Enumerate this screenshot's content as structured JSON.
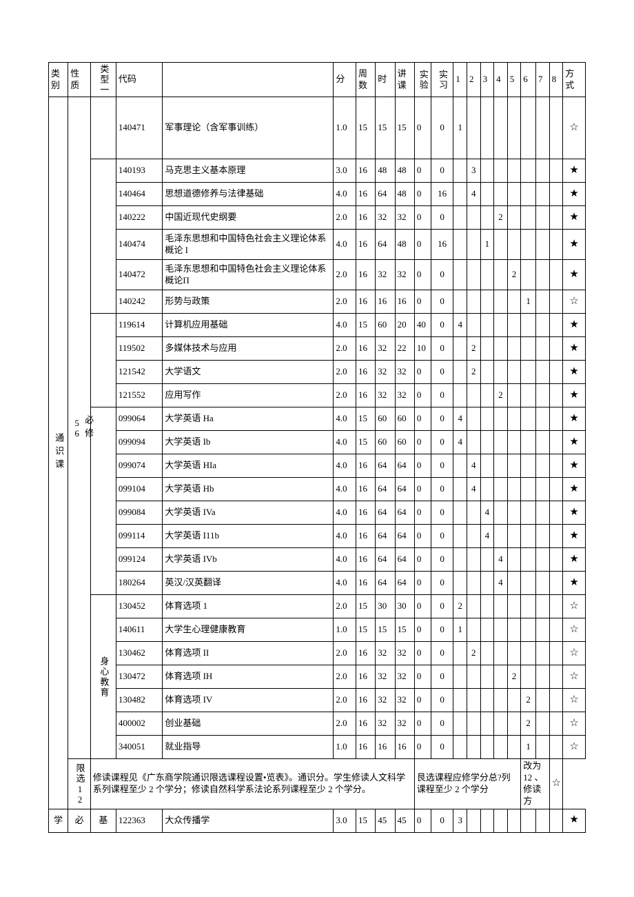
{
  "headers": {
    "cat": "类别",
    "nature": "性质",
    "type": "类型一",
    "code": "代码",
    "name": "",
    "credit": "分",
    "weeks": "周数",
    "hours": "时",
    "lecture": "讲课",
    "exp": "实验",
    "practice": "实习",
    "s1": "1",
    "s2": "2",
    "s3": "3",
    "s4": "4",
    "s5": "5",
    "s6": "6",
    "s7": "7",
    "s8": "8",
    "mode": "方式"
  },
  "left": {
    "tongshike": "通识课",
    "bixiu": "必修",
    "credits56": "56",
    "shenxin": "身心教育",
    "xianxuan": "限选",
    "credits12": "12",
    "xue": "学",
    "bi": "必",
    "ji": "基"
  },
  "rows": [
    {
      "code": "140471",
      "name": "军事理论（含军事训练）",
      "credit": "1.0",
      "weeks": "15",
      "hours": "15",
      "lecture": "15",
      "exp": "0",
      "practice": "0",
      "s1": "1",
      "s2": "",
      "s3": "",
      "s4": "",
      "s5": "",
      "s6": "",
      "s7": "",
      "s8": "",
      "mode": "☆"
    },
    {
      "code": "140193",
      "name": "马克思主义基本原理",
      "credit": "3.0",
      "weeks": "16",
      "hours": "48",
      "lecture": "48",
      "exp": "0",
      "practice": "0",
      "s1": "",
      "s2": "3",
      "s3": "",
      "s4": "",
      "s5": "",
      "s6": "",
      "s7": "",
      "s8": "",
      "mode": "★"
    },
    {
      "code": "140464",
      "name": "思想道德修养与法律基础",
      "credit": "4.0",
      "weeks": "16",
      "hours": "64",
      "lecture": "48",
      "exp": "0",
      "practice": "16",
      "s1": "",
      "s2": "4",
      "s3": "",
      "s4": "",
      "s5": "",
      "s6": "",
      "s7": "",
      "s8": "",
      "mode": "★"
    },
    {
      "code": "140222",
      "name": "中国近现代史纲要",
      "credit": "2.0",
      "weeks": "16",
      "hours": "32",
      "lecture": "32",
      "exp": "0",
      "practice": "0",
      "s1": "",
      "s2": "",
      "s3": "",
      "s4": "2",
      "s5": "",
      "s6": "",
      "s7": "",
      "s8": "",
      "mode": "★"
    },
    {
      "code": "140474",
      "name": "毛泽东思想和中国特色社会主义理论体系概论 I",
      "credit": "4.0",
      "weeks": "16",
      "hours": "64",
      "lecture": "48",
      "exp": "0",
      "practice": "16",
      "s1": "",
      "s2": "",
      "s3": "1",
      "s4": "",
      "s5": "",
      "s6": "",
      "s7": "",
      "s8": "",
      "mode": "★"
    },
    {
      "code": "140472",
      "name": "毛泽东思想和中国特色社会主义理论体系概论Π",
      "credit": "2.0",
      "weeks": "16",
      "hours": "32",
      "lecture": "32",
      "exp": "0",
      "practice": "0",
      "s1": "",
      "s2": "",
      "s3": "",
      "s4": "",
      "s5": "2",
      "s6": "",
      "s7": "",
      "s8": "",
      "mode": "★"
    },
    {
      "code": "140242",
      "name": "形势与政策",
      "credit": "2.0",
      "weeks": "16",
      "hours": "16",
      "lecture": "16",
      "exp": "0",
      "practice": "0",
      "s1": "",
      "s2": "",
      "s3": "",
      "s4": "",
      "s5": "",
      "s6": "1",
      "s7": "",
      "s8": "",
      "mode": "☆"
    },
    {
      "code": "119614",
      "name": "计算机应用基础",
      "credit": "4.0",
      "weeks": "15",
      "hours": "60",
      "lecture": "20",
      "exp": "40",
      "practice": "0",
      "s1": "4",
      "s2": "",
      "s3": "",
      "s4": "",
      "s5": "",
      "s6": "",
      "s7": "",
      "s8": "",
      "mode": "★"
    },
    {
      "code": "119502",
      "name": "多媒体技术与应用",
      "credit": "2.0",
      "weeks": "16",
      "hours": "32",
      "lecture": "22",
      "exp": "10",
      "practice": "0",
      "s1": "",
      "s2": "2",
      "s3": "",
      "s4": "",
      "s5": "",
      "s6": "",
      "s7": "",
      "s8": "",
      "mode": "★"
    },
    {
      "code": "121542",
      "name": "大学语文",
      "credit": "2.0",
      "weeks": "16",
      "hours": "32",
      "lecture": "32",
      "exp": "0",
      "practice": "0",
      "s1": "",
      "s2": "2",
      "s3": "",
      "s4": "",
      "s5": "",
      "s6": "",
      "s7": "",
      "s8": "",
      "mode": "★"
    },
    {
      "code": "121552",
      "name": "应用写作",
      "credit": "2.0",
      "weeks": "16",
      "hours": "32",
      "lecture": "32",
      "exp": "0",
      "practice": "0",
      "s1": "",
      "s2": "",
      "s3": "",
      "s4": "2",
      "s5": "",
      "s6": "",
      "s7": "",
      "s8": "",
      "mode": "★"
    },
    {
      "code": "099064",
      "name": "大学英语 Ha",
      "credit": "4.0",
      "weeks": "15",
      "hours": "60",
      "lecture": "60",
      "exp": "0",
      "practice": "0",
      "s1": "4",
      "s2": "",
      "s3": "",
      "s4": "",
      "s5": "",
      "s6": "",
      "s7": "",
      "s8": "",
      "mode": "★"
    },
    {
      "code": "099094",
      "name": "大学英语 Ib",
      "credit": "4.0",
      "weeks": "15",
      "hours": "60",
      "lecture": "60",
      "exp": "0",
      "practice": "0",
      "s1": "4",
      "s2": "",
      "s3": "",
      "s4": "",
      "s5": "",
      "s6": "",
      "s7": "",
      "s8": "",
      "mode": "★"
    },
    {
      "code": "099074",
      "name": "大学英语 HIa",
      "credit": "4.0",
      "weeks": "16",
      "hours": "64",
      "lecture": "64",
      "exp": "0",
      "practice": "0",
      "s1": "",
      "s2": "4",
      "s3": "",
      "s4": "",
      "s5": "",
      "s6": "",
      "s7": "",
      "s8": "",
      "mode": "★"
    },
    {
      "code": "099104",
      "name": "大学英语 Hb",
      "credit": "4.0",
      "weeks": "16",
      "hours": "64",
      "lecture": "64",
      "exp": "0",
      "practice": "0",
      "s1": "",
      "s2": "4",
      "s3": "",
      "s4": "",
      "s5": "",
      "s6": "",
      "s7": "",
      "s8": "",
      "mode": "★"
    },
    {
      "code": "099084",
      "name": "大学英语 IVa",
      "credit": "4.0",
      "weeks": "16",
      "hours": "64",
      "lecture": "64",
      "exp": "0",
      "practice": "0",
      "s1": "",
      "s2": "",
      "s3": "4",
      "s4": "",
      "s5": "",
      "s6": "",
      "s7": "",
      "s8": "",
      "mode": "★"
    },
    {
      "code": "099114",
      "name": "大学英语 I11b",
      "credit": "4.0",
      "weeks": "16",
      "hours": "64",
      "lecture": "64",
      "exp": "0",
      "practice": "0",
      "s1": "",
      "s2": "",
      "s3": "4",
      "s4": "",
      "s5": "",
      "s6": "",
      "s7": "",
      "s8": "",
      "mode": "★"
    },
    {
      "code": "099124",
      "name": "大学英语 IVb",
      "credit": "4.0",
      "weeks": "16",
      "hours": "64",
      "lecture": "64",
      "exp": "0",
      "practice": "0",
      "s1": "",
      "s2": "",
      "s3": "",
      "s4": "4",
      "s5": "",
      "s6": "",
      "s7": "",
      "s8": "",
      "mode": "★"
    },
    {
      "code": "180264",
      "name": "英汉/汉英翻译",
      "credit": "4.0",
      "weeks": "16",
      "hours": "64",
      "lecture": "64",
      "exp": "0",
      "practice": "0",
      "s1": "",
      "s2": "",
      "s3": "",
      "s4": "4",
      "s5": "",
      "s6": "",
      "s7": "",
      "s8": "",
      "mode": "★"
    },
    {
      "code": "130452",
      "name": "体育选项 1",
      "credit": "2.0",
      "weeks": "15",
      "hours": "30",
      "lecture": "30",
      "exp": "0",
      "practice": "0",
      "s1": "2",
      "s2": "",
      "s3": "",
      "s4": "",
      "s5": "",
      "s6": "",
      "s7": "",
      "s8": "",
      "mode": "☆"
    },
    {
      "code": "140611",
      "name": "大学生心理健康教育",
      "credit": "1.0",
      "weeks": "15",
      "hours": "15",
      "lecture": "15",
      "exp": "0",
      "practice": "0",
      "s1": "1",
      "s2": "",
      "s3": "",
      "s4": "",
      "s5": "",
      "s6": "",
      "s7": "",
      "s8": "",
      "mode": "☆"
    },
    {
      "code": "130462",
      "name": "体育选项 II",
      "credit": "2.0",
      "weeks": "16",
      "hours": "32",
      "lecture": "32",
      "exp": "0",
      "practice": "0",
      "s1": "",
      "s2": "2",
      "s3": "",
      "s4": "",
      "s5": "",
      "s6": "",
      "s7": "",
      "s8": "",
      "mode": "☆"
    },
    {
      "code": "130472",
      "name": "体育选项 IH",
      "credit": "2.0",
      "weeks": "16",
      "hours": "32",
      "lecture": "32",
      "exp": "0",
      "practice": "0",
      "s1": "",
      "s2": "",
      "s3": "",
      "s4": "",
      "s5": "2",
      "s6": "",
      "s7": "",
      "s8": "",
      "mode": "☆"
    },
    {
      "code": "130482",
      "name": "体育选项 IV",
      "credit": "2.0",
      "weeks": "16",
      "hours": "32",
      "lecture": "32",
      "exp": "0",
      "practice": "0",
      "s1": "",
      "s2": "",
      "s3": "",
      "s4": "",
      "s5": "",
      "s6": "2",
      "s7": "",
      "s8": "",
      "mode": "☆"
    },
    {
      "code": "400002",
      "name": "创业基础",
      "credit": "2.0",
      "weeks": "16",
      "hours": "32",
      "lecture": "32",
      "exp": "0",
      "practice": "0",
      "s1": "",
      "s2": "",
      "s3": "",
      "s4": "",
      "s5": "",
      "s6": "2",
      "s7": "",
      "s8": "",
      "mode": "☆"
    },
    {
      "code": "340051",
      "name": "就业指导",
      "credit": "1.0",
      "weeks": "16",
      "hours": "16",
      "lecture": "16",
      "exp": "0",
      "practice": "0",
      "s1": "",
      "s2": "",
      "s3": "",
      "s4": "",
      "s5": "",
      "s6": "1",
      "s7": "",
      "s8": "",
      "mode": "☆"
    }
  ],
  "note": {
    "left": "修读课程见《广东商学院通识限选课程设置•览表》。通识分。学生修读人文科学系列课程至少 2 个学分；修读自然科学系法论系列课程至少 2 个学分。",
    "mid": "艮选课程应修学分总?列课程至少 2 个学分",
    "right": "改为 12 、修读方",
    "mode": "☆"
  },
  "last": {
    "code": "122363",
    "name": "大众传播学",
    "credit": "3.0",
    "weeks": "15",
    "hours": "45",
    "lecture": "45",
    "exp": "0",
    "practice": "0",
    "s1": "3",
    "mode": "★"
  }
}
